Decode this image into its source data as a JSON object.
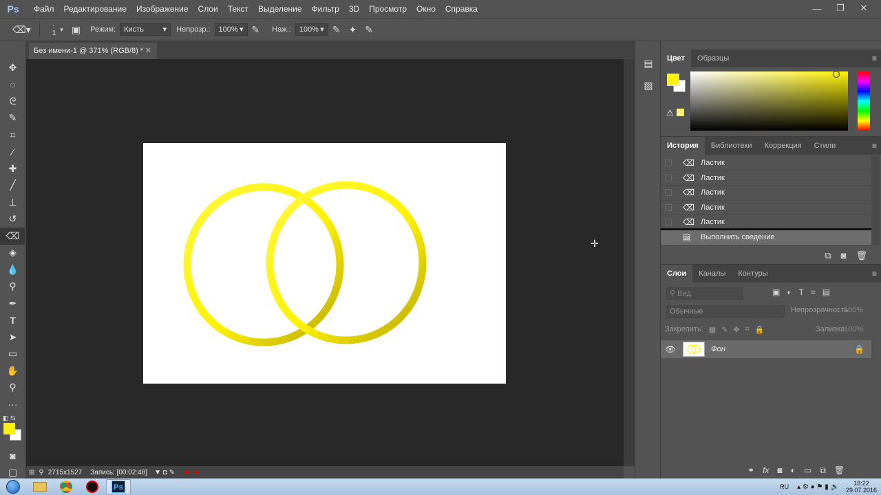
{
  "app": {
    "logo": "Ps",
    "menu": [
      "Файл",
      "Редактирование",
      "Изображение",
      "Слои",
      "Текст",
      "Выделение",
      "Фильтр",
      "3D",
      "Просмотр",
      "Окно",
      "Справка"
    ],
    "window_controls": {
      "minimize": "—",
      "restore": "❐",
      "close": "✕"
    }
  },
  "options": {
    "brush_size": "1",
    "mode_label": "Режим:",
    "mode_value": "Кисть",
    "opacity_label": "Непрозр.:",
    "opacity_value": "100%",
    "flow_label": "Наж.:",
    "flow_value": "100%"
  },
  "document": {
    "tab_title": "Без имени-1 @ 371% (RGB/8) *",
    "tab_close": "✕"
  },
  "status": {
    "dimensions": "2715x1527",
    "recording": "Запись: [00:02:48]"
  },
  "color_panel": {
    "tabs": [
      "Цвет",
      "Образцы"
    ],
    "foreground": "#fff200",
    "background": "#ffffff"
  },
  "history_panel": {
    "tabs": [
      "История",
      "Библиотеки",
      "Коррекция",
      "Стили"
    ],
    "items": [
      {
        "label": "Ластик"
      },
      {
        "label": "Ластик"
      },
      {
        "label": "Ластик"
      },
      {
        "label": "Ластик"
      },
      {
        "label": "Ластик"
      },
      {
        "label": "Выполнить сведение"
      }
    ]
  },
  "layers_panel": {
    "tabs": [
      "Слои",
      "Каналы",
      "Контуры"
    ],
    "search_placeholder": "Вид",
    "blend_mode": "Обычные",
    "opacity_label": "Непрозрачность:",
    "opacity_value": "100%",
    "lock_label": "Закрепить:",
    "fill_label": "Заливка:",
    "fill_value": "100%",
    "layer_name": "Фон"
  },
  "taskbar": {
    "language": "RU",
    "time": "18:22",
    "date": "29.07.2016",
    "ps_label": "Ps"
  },
  "colors": {
    "ring_yellow": "#fff200",
    "ui_gray": "#535353",
    "canvas_bg": "#282828"
  }
}
